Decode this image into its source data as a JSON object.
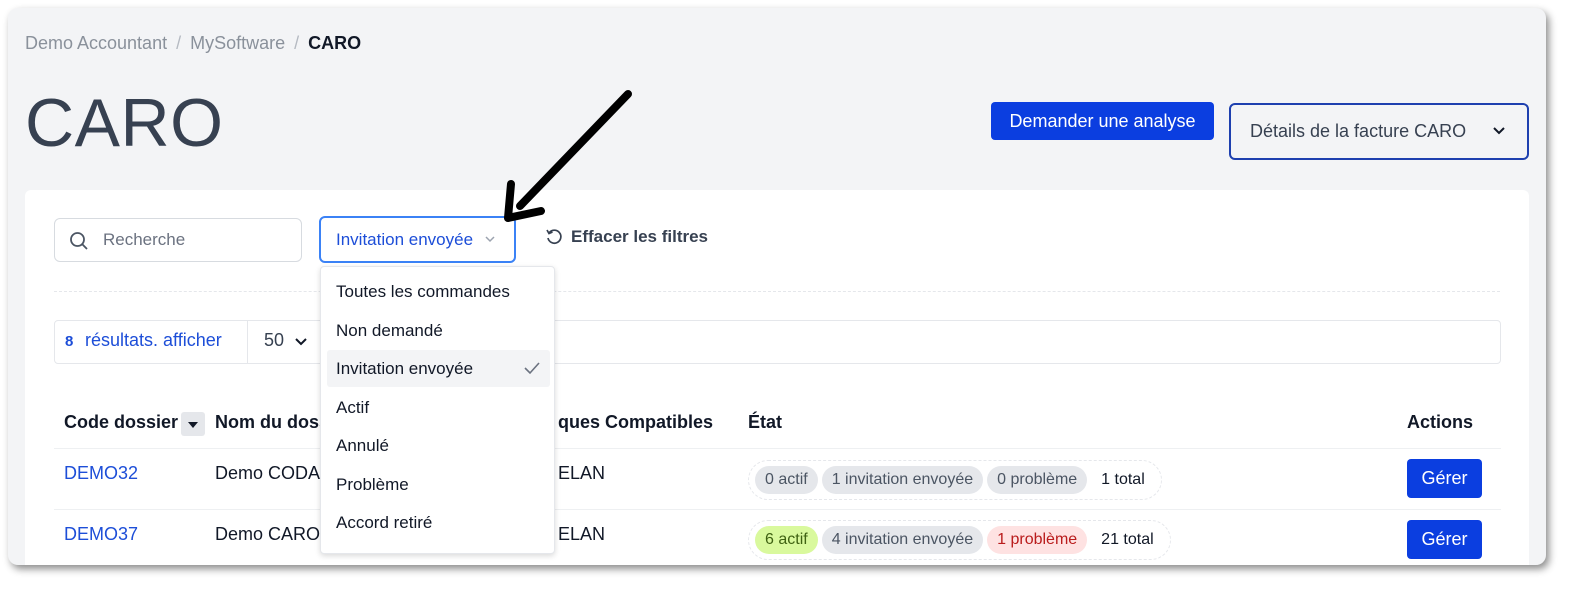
{
  "breadcrumb": {
    "items": [
      "Demo Accountant",
      "MySoftware"
    ],
    "current": "CARO",
    "separator": "/"
  },
  "page": {
    "title": "CARO"
  },
  "header_buttons": {
    "analyse": "Demander une analyse",
    "details": "Détails de la facture CARO"
  },
  "filters": {
    "search_placeholder": "Recherche",
    "status_selected": "Invitation envoyée",
    "clear_label": "Effacer les filtres"
  },
  "results": {
    "count": "8",
    "label": "résultats. afficher",
    "per_page": "50"
  },
  "table": {
    "columns": [
      "Code dossier",
      "Nom du doss",
      "ques Compatibles",
      "État",
      "Actions"
    ],
    "rows": [
      {
        "code": "DEMO32",
        "name": "Demo CODA",
        "compat": "ELAN",
        "states": [
          {
            "label": "0 actif",
            "tone": "gray"
          },
          {
            "label": "1 invitation envoyée",
            "tone": "gray"
          },
          {
            "label": "0 problème",
            "tone": "gray"
          }
        ],
        "total": "1 total",
        "action": "Gérer"
      },
      {
        "code": "DEMO37",
        "name": "Demo CARO",
        "compat": "ELAN",
        "states": [
          {
            "label": "6 actif",
            "tone": "green"
          },
          {
            "label": "4 invitation envoyée",
            "tone": "gray"
          },
          {
            "label": "1 problème",
            "tone": "red"
          }
        ],
        "total": "21 total",
        "action": "Gérer"
      }
    ]
  },
  "dropdown": {
    "options": [
      "Toutes les commandes",
      "Non demandé",
      "Invitation envoyée",
      "Actif",
      "Annulé",
      "Problème",
      "Accord retiré"
    ],
    "selected_index": 2
  },
  "colors": {
    "primary": "#0b3ee0",
    "link": "#1d4ed8",
    "focus": "#3b82f6",
    "annotation_arrow": "#000000"
  },
  "icons": [
    "search-icon",
    "chevron-down-icon",
    "reset-icon",
    "sort-down-icon",
    "check-icon",
    "annotation-arrow-icon"
  ]
}
